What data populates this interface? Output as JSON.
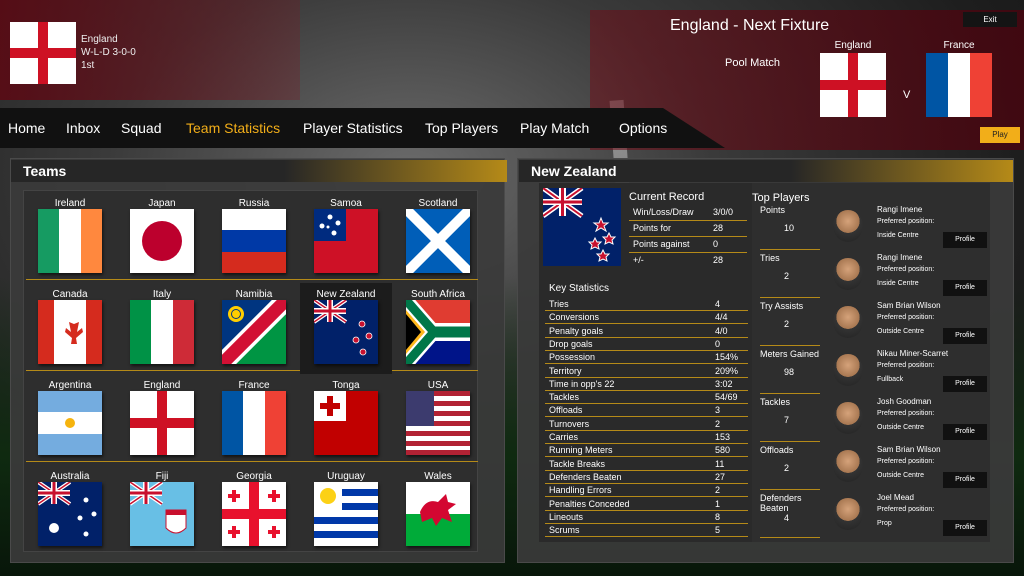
{
  "header": {
    "team": "England",
    "record": "W-L-D 3-0-0",
    "position": "1st"
  },
  "fixture": {
    "title": "England  - Next Fixture",
    "competition": "Pool Match",
    "home": "England",
    "away": "France",
    "vs": "V",
    "exit": "Exit",
    "play": "Play"
  },
  "nav": [
    "Home",
    "Inbox",
    "Squad",
    "Team Statistics",
    "Player Statistics",
    "Top Players",
    "Play Match",
    "Options"
  ],
  "teams_panel": {
    "title": "Teams",
    "teams": [
      "Ireland",
      "Japan",
      "Russia",
      "Samoa",
      "Scotland",
      "Canada",
      "Italy",
      "Namibia",
      "New Zealand",
      "South Africa",
      "Argentina",
      "England",
      "France",
      "Tonga",
      "USA",
      "Australia",
      "Fiji",
      "Georgia",
      "Uruguay",
      "Wales"
    ],
    "selected": "New Zealand"
  },
  "detail": {
    "title": "New Zealand",
    "record": {
      "heading": "Current Record",
      "rows": [
        [
          "Win/Loss/Draw",
          "3/0/0"
        ],
        [
          "Points for",
          "28"
        ],
        [
          "Points against",
          "0"
        ],
        [
          "+/-",
          "28"
        ]
      ]
    },
    "key_stats": {
      "heading": "Key Statistics",
      "rows": [
        [
          "Tries",
          "4"
        ],
        [
          "Conversions",
          "4/4"
        ],
        [
          "Penalty goals",
          "4/0"
        ],
        [
          "Drop goals",
          "0"
        ],
        [
          "Possession",
          "154%"
        ],
        [
          "Territory",
          "209%"
        ],
        [
          "Time in opp's 22",
          "3:02"
        ],
        [
          "Tackles",
          "54/69"
        ],
        [
          "Offloads",
          "3"
        ],
        [
          "Turnovers",
          "2"
        ],
        [
          "Carries",
          "153"
        ],
        [
          "Running Meters",
          "580"
        ],
        [
          "Tackle Breaks",
          "11"
        ],
        [
          "Defenders Beaten",
          "27"
        ],
        [
          "Handling Errors",
          "2"
        ],
        [
          "Penalties Conceded",
          "1"
        ],
        [
          "Lineouts",
          "8"
        ],
        [
          "Scrums",
          "5"
        ]
      ]
    },
    "top_players": {
      "heading": "Top Players",
      "pos_label": "Preferred position:",
      "profile": "Profile",
      "items": [
        {
          "stat": "Points",
          "value": "10",
          "name": "Rangi Imene",
          "position": "Inside Centre"
        },
        {
          "stat": "Tries",
          "value": "2",
          "name": "Rangi Imene",
          "position": "Inside Centre"
        },
        {
          "stat": "Try Assists",
          "value": "2",
          "name": "Sam Brian Wilson",
          "position": "Outside Centre"
        },
        {
          "stat": "Meters Gained",
          "value": "98",
          "name": "Nikau Miner-Scarret",
          "position": "Fullback"
        },
        {
          "stat": "Tackles",
          "value": "7",
          "name": "Josh Goodman",
          "position": "Outside Centre"
        },
        {
          "stat": "Offloads",
          "value": "2",
          "name": "Sam Brian Wilson",
          "position": "Outside Centre"
        },
        {
          "stat": "Defenders Beaten",
          "value": "4",
          "name": "Joel Mead",
          "position": "Prop"
        }
      ]
    }
  }
}
